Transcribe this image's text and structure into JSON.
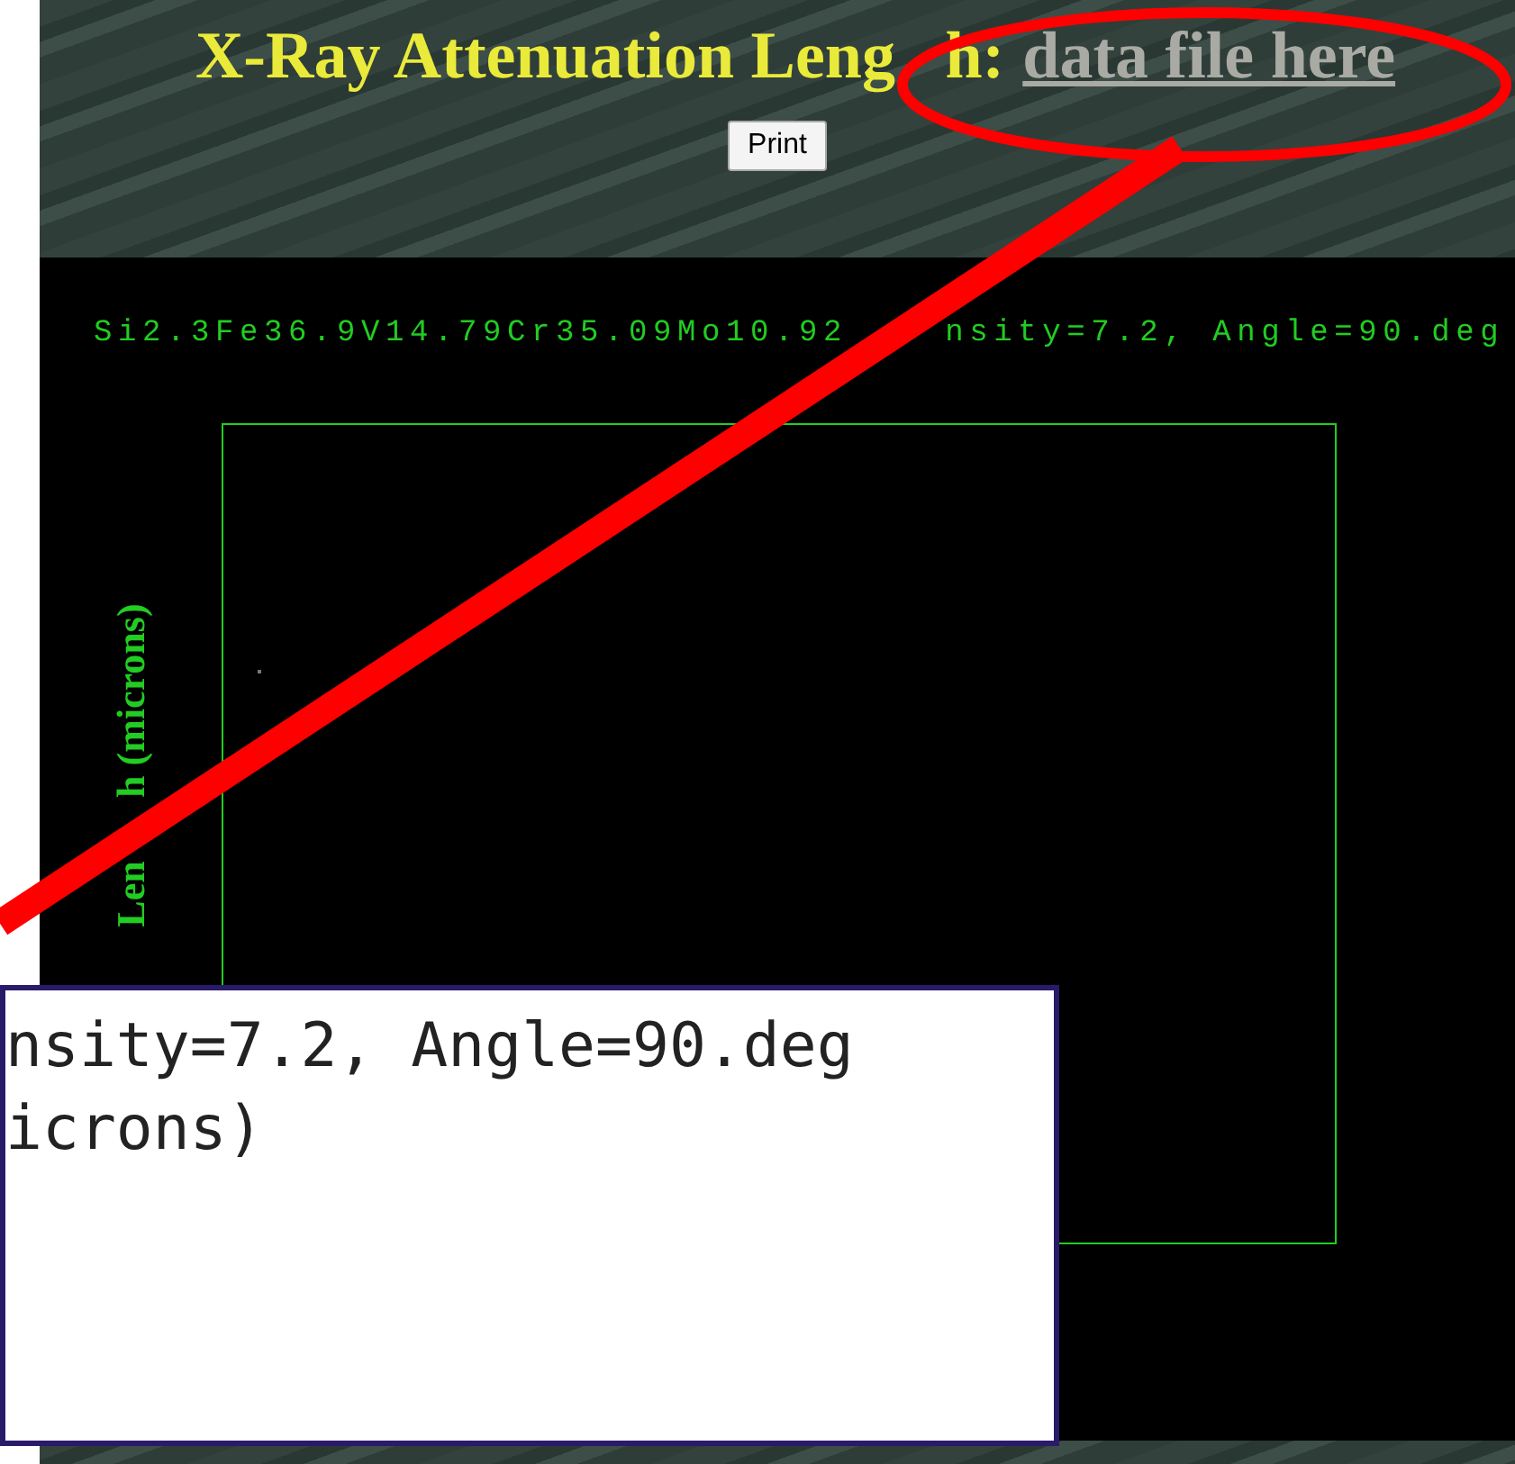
{
  "page": {
    "title_parts": [
      "X-Ray Attenuation Leng",
      "h:"
    ],
    "link": "data file here",
    "print_button": "Print"
  },
  "plot": {
    "heading_parts": [
      "Si2.3Fe36.9V14.79Cr35.09Mo10.92",
      "nsity=7.2, Angle=90.deg"
    ],
    "ylabel_parts": [
      "Len",
      "h (microns)"
    ]
  },
  "overlay": {
    "lines": [
      "nsity=7.2, Angle=90.deg",
      "icrons)"
    ]
  }
}
